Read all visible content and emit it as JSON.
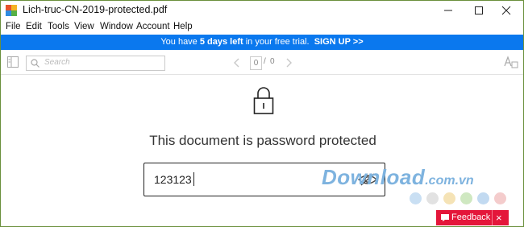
{
  "window": {
    "title": "Lich-truc-CN-2019-protected.pdf",
    "controls": {
      "minimize": "minimize",
      "maximize": "maximize",
      "close": "close"
    }
  },
  "menu": {
    "items": [
      "File",
      "Edit",
      "Tools",
      "View",
      "Window",
      "Account",
      "Help"
    ]
  },
  "trial_banner": {
    "prefix": "You have ",
    "days": "5 days left",
    "suffix": " in your free trial.",
    "cta": "SIGN UP >>",
    "color": "#0a78ee"
  },
  "toolbar": {
    "search_placeholder": "Search",
    "page_current": "0",
    "page_separator": "/",
    "page_total": "0"
  },
  "document": {
    "message": "This document is password protected",
    "password_value": "123123"
  },
  "watermark": {
    "main": "Download",
    "sub": ".com.vn"
  },
  "feedback": {
    "label": "Feedback",
    "close": "×",
    "color": "#e4163a"
  }
}
